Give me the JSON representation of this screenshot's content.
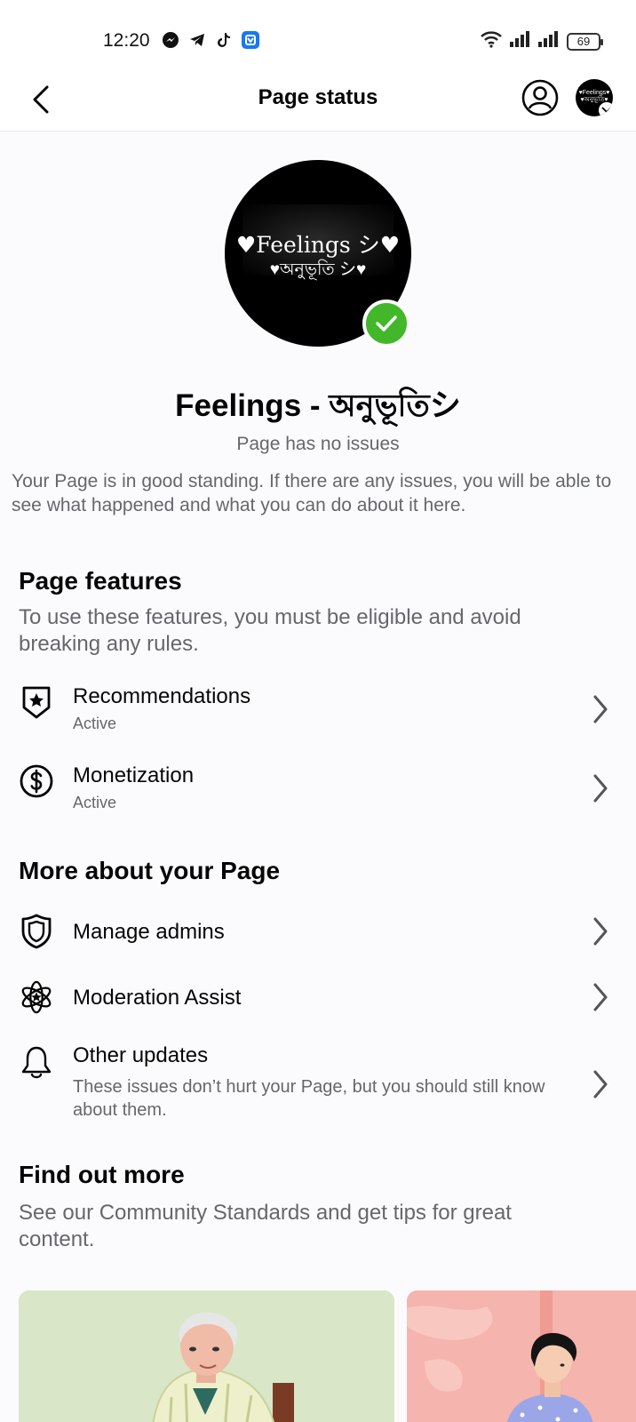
{
  "status_bar": {
    "time": "12:20",
    "battery": "69"
  },
  "header": {
    "title": "Page status"
  },
  "page": {
    "avatar_line1": "♥Feelings シ♥",
    "avatar_line2": "♥অনুভূতি シ♥",
    "avatar_mini": "♥Feelings♥ ♥অনুভূতি♥",
    "name": "Feelings - অনুভূতিシ",
    "health": "Page has no issues",
    "description": "Your Page is in good standing. If there are any issues, you will be able to see what happened and what you can do about it here."
  },
  "features": {
    "title": "Page features",
    "subtitle": "To use these features, you must be eligible and avoid breaking any rules.",
    "items": [
      {
        "label": "Recommendations",
        "status": "Active"
      },
      {
        "label": "Monetization",
        "status": "Active"
      }
    ]
  },
  "more": {
    "title": "More about your Page",
    "items": [
      {
        "label": "Manage admins"
      },
      {
        "label": "Moderation Assist"
      },
      {
        "label": "Other updates",
        "description": "These issues don’t hurt your Page, but you should still know about them."
      }
    ]
  },
  "find_out": {
    "title": "Find out more",
    "subtitle": "See our Community Standards and get tips for great content."
  },
  "colors": {
    "verified": "#42b72a",
    "secondary_text": "#65676b"
  }
}
